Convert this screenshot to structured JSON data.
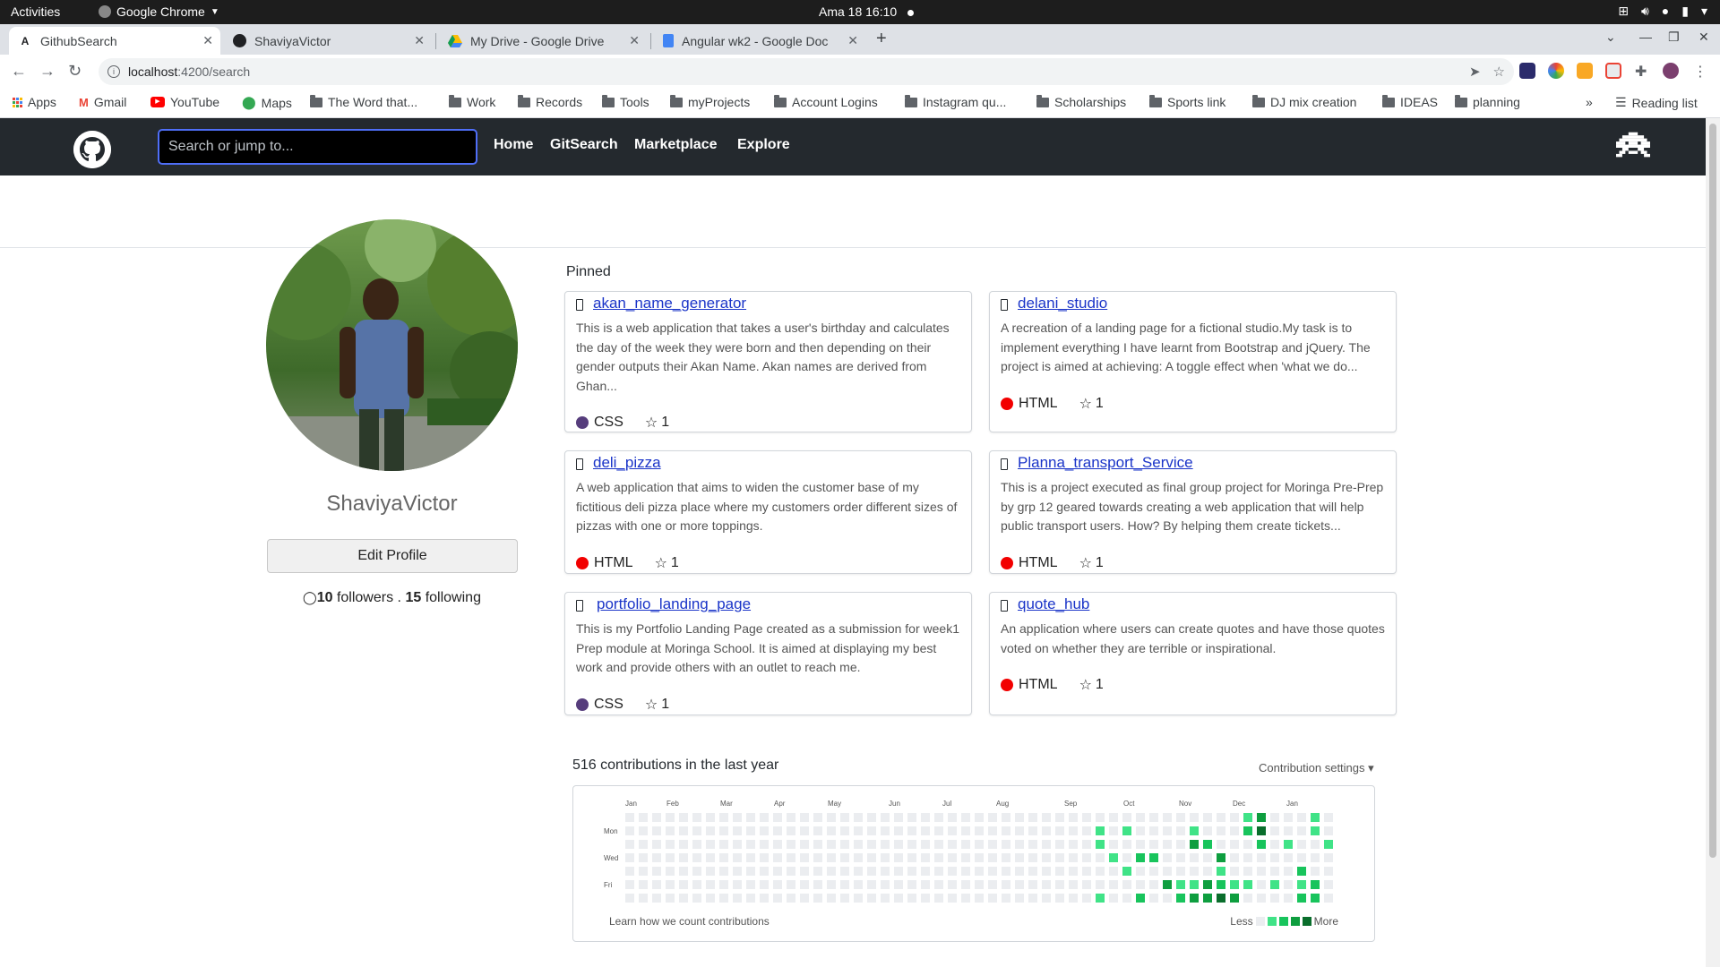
{
  "os_bar": {
    "activities": "Activities",
    "app_name": "Google Chrome",
    "clock": "Ama 18  16:10"
  },
  "browser": {
    "tabs": [
      {
        "title": "GithubSearch",
        "active": true
      },
      {
        "title": "ShaviyaVictor",
        "active": false
      },
      {
        "title": "My Drive - Google Drive",
        "active": false
      },
      {
        "title": "Angular wk2 - Google Doc",
        "active": false
      }
    ],
    "url_host": "localhost",
    "url_path": ":4200/search",
    "bookmarks": [
      "Apps",
      "Gmail",
      "YouTube",
      "Maps",
      "The Word that...",
      "Work",
      "Records",
      "Tools",
      "myProjects",
      "Account Logins",
      "Instagram qu...",
      "Scholarships",
      "Sports link",
      "DJ mix creation",
      "IDEAS",
      "planning"
    ],
    "more_bookmarks": "»",
    "reading_list": "Reading list"
  },
  "navbar": {
    "search_placeholder": "Search or jump to...",
    "links": [
      "Home",
      "GitSearch",
      "Marketplace",
      "Explore"
    ]
  },
  "profile": {
    "username": "ShaviyaVictor",
    "edit_button": "Edit Profile",
    "followers_count": "10",
    "followers_label": "followers",
    "separator": ".",
    "following_count": "15",
    "following_label": "following"
  },
  "pinned": {
    "title": "Pinned",
    "repos": [
      {
        "name": "akan_name_generator",
        "description": "This is a web application that takes a user's birthday and calculates the day of the week they were born and then depending on their gender outputs their Akan Name. Akan names are derived from Ghan...",
        "language": "CSS",
        "language_color": "#563d7c",
        "stars": "1"
      },
      {
        "name": "delani_studio",
        "description": "A recreation of a landing page for a fictional studio.My task is to implement everything I have learnt from Bootstrap and jQuery. The project is aimed at achieving: A toggle effect when 'what we do...",
        "language": "HTML",
        "language_color": "#f20000",
        "stars": "1"
      },
      {
        "name": "deli_pizza",
        "description": "A web application that aims to widen the customer base of my fictitious deli pizza place where my customers order different sizes of pizzas with one or more toppings.",
        "language": "HTML",
        "language_color": "#f20000",
        "stars": "1"
      },
      {
        "name": "Planna_transport_Service",
        "description": "This is a project executed as final group project for Moringa Pre-Prep by grp 12 geared towards creating a web application that will help public transport users. How? By helping them create tickets...",
        "language": "HTML",
        "language_color": "#f20000",
        "stars": "1"
      },
      {
        "name": "portfolio_landing_page",
        "description": "This is my Portfolio Landing Page created as a submission for week1 Prep module at Moringa School. It is aimed at displaying my best work and provide others with an outlet to reach me.",
        "language": "CSS",
        "language_color": "#563d7c",
        "stars": "1"
      },
      {
        "name": "quote_hub",
        "description": "An application where users can create quotes and have those quotes voted on whether they are terrible or inspirational.",
        "language": "HTML",
        "language_color": "#f20000",
        "stars": "1"
      }
    ]
  },
  "contributions": {
    "title": "516 contributions in the last year",
    "settings": "Contribution settings",
    "months": [
      "Jan",
      "Feb",
      "Mar",
      "Apr",
      "May",
      "Jun",
      "Jul",
      "Aug",
      "Sep",
      "Oct",
      "Nov",
      "Dec",
      "Jan"
    ],
    "days": [
      "Mon",
      "Wed",
      "Fri"
    ],
    "learn_link": "Learn how we count contributions",
    "legend_less": "Less",
    "legend_more": "More",
    "level_colors": [
      "#ebedf0",
      "#40e387",
      "#18c45c",
      "#0e9e3f",
      "#0a6e2c"
    ]
  }
}
